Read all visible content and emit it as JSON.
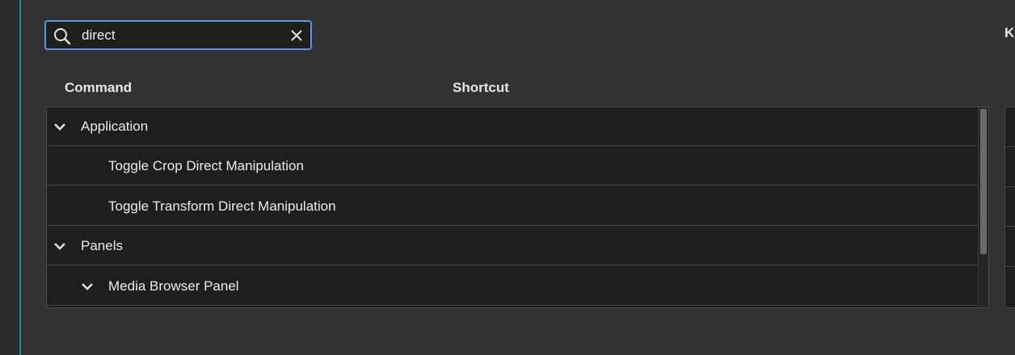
{
  "search": {
    "value": "direct",
    "placeholder": ""
  },
  "right_label": "Ke",
  "table": {
    "headers": {
      "command": "Command",
      "shortcut": "Shortcut"
    },
    "rows": [
      {
        "label": "Application",
        "type": "group",
        "expanded": true,
        "level": 0
      },
      {
        "label": "Toggle Crop Direct Manipulation",
        "type": "command",
        "level": 1
      },
      {
        "label": "Toggle Transform Direct Manipulation",
        "type": "command",
        "level": 1
      },
      {
        "label": "Panels",
        "type": "group",
        "expanded": true,
        "level": 0
      },
      {
        "label": "Media Browser Panel",
        "type": "group",
        "expanded": true,
        "level": 1
      }
    ]
  },
  "icons": {
    "search": "search-icon",
    "clear": "close-icon",
    "expand": "chevron-down-icon"
  },
  "colors": {
    "focus_border": "#5b9be6",
    "accent_strip": "#2a8a8a",
    "background": "#323232",
    "table_bg": "#1e1e1e"
  }
}
